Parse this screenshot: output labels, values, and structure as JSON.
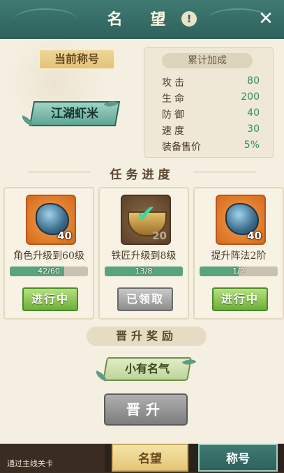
{
  "header": {
    "title": "名 望",
    "info_glyph": "!",
    "close_glyph": "✕"
  },
  "current_title": {
    "label": "当前称号",
    "name": "江湖虾米"
  },
  "stats": {
    "heading": "累计加成",
    "rows": [
      {
        "label": "攻击",
        "value": "80"
      },
      {
        "label": "生命",
        "value": "200"
      },
      {
        "label": "防御",
        "value": "40"
      },
      {
        "label": "速度",
        "value": "30"
      },
      {
        "label": "装备售价",
        "value": "5%"
      }
    ]
  },
  "tasks": {
    "heading": "任务进度",
    "items": [
      {
        "name": "角色升级到60级",
        "item_icon": "blue-gem-icon",
        "item_count": "40",
        "progress_text": "42/60",
        "progress": 0.7,
        "button": "进行中",
        "state": "active"
      },
      {
        "name": "铁匠升级到8级",
        "item_icon": "gold-ingot-icon",
        "item_count": "20",
        "progress_text": "13/8",
        "progress": 1.0,
        "button": "已领取",
        "state": "claimed"
      },
      {
        "name": "提升阵法2阶",
        "item_icon": "blue-gem-icon",
        "item_count": "40",
        "progress_text": "1/2",
        "progress": 0.5,
        "button": "进行中",
        "state": "active"
      }
    ]
  },
  "reward": {
    "heading": "晋升奖励",
    "title_name": "小有名气"
  },
  "promote_button": "晋升",
  "bottom": {
    "background_text": "通过主线关卡",
    "tabs": [
      {
        "label": "名望",
        "selected": true
      },
      {
        "label": "称号",
        "selected": false
      }
    ]
  },
  "colors": {
    "header": "#2f615b",
    "panel": "#f4efe1",
    "accent_green": "#58a57d",
    "gold": "#e2c676"
  }
}
